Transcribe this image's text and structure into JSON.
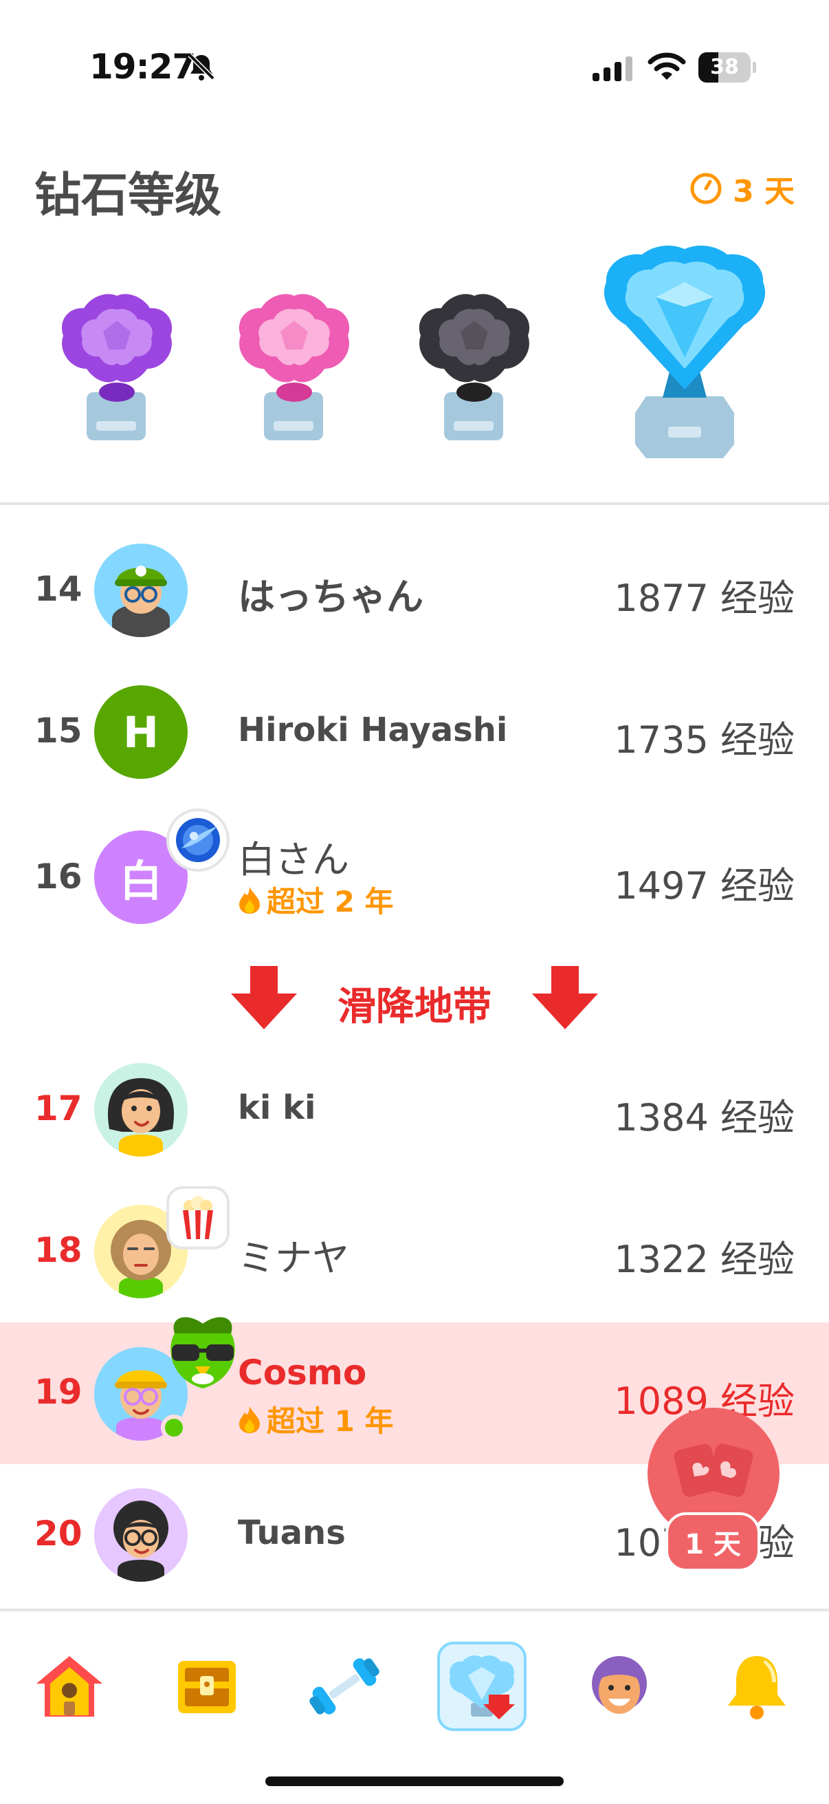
{
  "status_bar": {
    "time": "19:27",
    "battery_level": "38",
    "battery_fraction": 0.38,
    "icons": [
      "bell-off-icon",
      "signal-icon",
      "wifi-icon",
      "battery-icon"
    ]
  },
  "header": {
    "title": "钻石等级",
    "timer": "3 天",
    "timer_icon": "clock-icon"
  },
  "trophies": [
    "amethyst-trophy-icon",
    "pearl-trophy-icon",
    "obsidian-trophy-icon",
    "diamond-trophy-icon"
  ],
  "demotion_zone": {
    "label": "滑降地带",
    "icon": "arrow-down-icon"
  },
  "leaderboard": [
    {
      "rank": "14",
      "name": "はっちゃん",
      "xp": "1877 经验",
      "avatar": "avatar-green-cap"
    },
    {
      "rank": "15",
      "name": "Hiroki Hayashi",
      "xp": "1735 经验",
      "avatar_letter": "H",
      "avatar_color": "#58a700"
    },
    {
      "rank": "16",
      "name": "白さん",
      "xp": "1497 经验",
      "streak": "超过 2 年",
      "avatar_letter": "白",
      "avatar_color": "#ce82ff",
      "badge": "galaxy-badge-icon"
    },
    {
      "rank": "17",
      "name": "ki ki",
      "xp": "1384 经验",
      "avatar": "avatar-black-hair"
    },
    {
      "rank": "18",
      "name": "ミナヤ",
      "xp": "1322 经验",
      "avatar": "avatar-curly-hair",
      "badge": "popcorn-badge-icon"
    },
    {
      "rank": "19",
      "name": "Cosmo",
      "xp": "1089 经验",
      "streak": "超过 1 年",
      "avatar": "avatar-yellow-hat",
      "badge": "sunglasses-owl-badge-icon",
      "is_current_user": true,
      "online": true
    },
    {
      "rank": "20",
      "name": "Tuans",
      "xp": "1077 经验",
      "avatar": "avatar-curly-glasses"
    }
  ],
  "floating": {
    "icon": "friends-quest-icon",
    "label": "1 天"
  },
  "bottom_nav": [
    {
      "icon": "home-icon",
      "active": false
    },
    {
      "icon": "treasure-chest-icon",
      "active": false
    },
    {
      "icon": "dumbbell-icon",
      "active": false
    },
    {
      "icon": "leaderboard-trophy-icon",
      "active": true
    },
    {
      "icon": "profile-icon",
      "active": false
    },
    {
      "icon": "bell-icon",
      "active": false
    }
  ],
  "colors": {
    "orange": "#ff9600",
    "red": "#ea2b2b",
    "highlight": "#ffdfe0",
    "text": "#4b4b4b"
  }
}
